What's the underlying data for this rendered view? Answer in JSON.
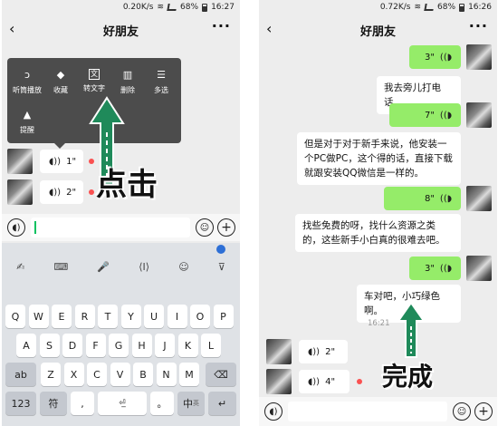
{
  "left": {
    "status": {
      "speed": "0.20K/s",
      "battery": "68%",
      "time": "16:27"
    },
    "nav": {
      "back": "‹",
      "title": "好朋友",
      "more": "···"
    },
    "menu": [
      {
        "label": "听筒播放",
        "icon": "ear-icon",
        "glyph": "ↄ"
      },
      {
        "label": "收藏",
        "icon": "cube-icon",
        "glyph": "◆"
      },
      {
        "label": "转文字",
        "icon": "translate-icon",
        "glyph": "文"
      },
      {
        "label": "删除",
        "icon": "trash-icon",
        "glyph": "🗑"
      },
      {
        "label": "多选",
        "icon": "list-icon",
        "glyph": "☰"
      },
      {
        "label": "提醒",
        "icon": "bell-icon",
        "glyph": "🔔"
      }
    ],
    "voices": [
      {
        "duration": "1\""
      },
      {
        "duration": "2\""
      }
    ],
    "annotation": "点击",
    "keyboard": {
      "row1": [
        "Q",
        "W",
        "E",
        "R",
        "T",
        "Y",
        "U",
        "I",
        "O",
        "P"
      ],
      "row2": [
        "A",
        "S",
        "D",
        "F",
        "G",
        "H",
        "J",
        "K",
        "L"
      ],
      "row3": [
        "Z",
        "X",
        "C",
        "V",
        "B",
        "N",
        "M"
      ],
      "shift": "ab",
      "num": "123",
      "sym": "符",
      "comma": ",",
      "period": "。",
      "lang": "中",
      "lang_sub": "英",
      "backspace": "⌫",
      "enter": "↵"
    }
  },
  "right": {
    "status": {
      "speed": "0.72K/s",
      "battery": "68%",
      "time": "16:26"
    },
    "nav": {
      "back": "‹",
      "title": "好朋友",
      "more": "···"
    },
    "messages": {
      "v1": "3\"",
      "t1": "我去旁儿打电话。",
      "v2": "7\"",
      "t2": "但是对于对于新手来说，他安装一个PC做PC，这个得的话，直接下载就跟安装QQ微信是一样的。",
      "v3": "8\"",
      "t3": "找些免费的呀，找什么资源之类的，这些新手小白真的很难去吧。",
      "v4": "3\"",
      "t4": "车对吧，小巧绿色啊。",
      "time": "16:21",
      "in1": "2\"",
      "in2": "4\""
    },
    "annotation": "完成"
  },
  "colors": {
    "accent": "#07c160",
    "bubble_out": "#95ec69",
    "arrow": "#1f8a5a",
    "unread": "#fa5151"
  }
}
